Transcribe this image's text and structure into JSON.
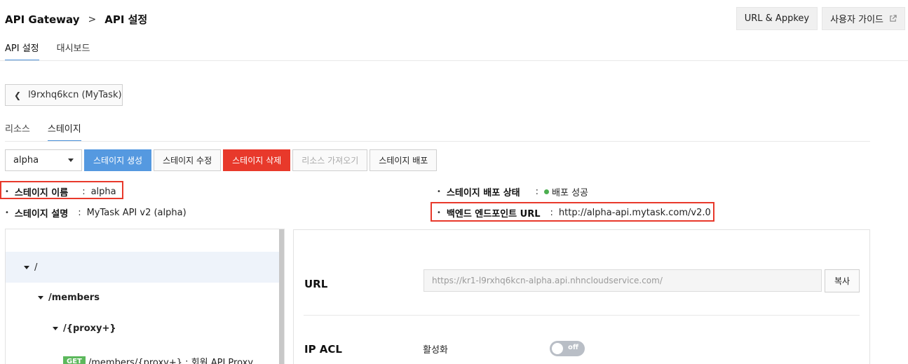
{
  "breadcrumb": {
    "root": "API Gateway",
    "separator": ">",
    "current": "API 설정"
  },
  "top_buttons": {
    "url_appkey": "URL & Appkey",
    "user_guide": "사용자 가이드"
  },
  "main_tabs": [
    {
      "label": "API 설정",
      "active": true
    },
    {
      "label": "대시보드",
      "active": false
    }
  ],
  "back_button": {
    "label": "l9rxhq6kcn (MyTask)"
  },
  "sub_tabs": [
    {
      "label": "리소스",
      "active": false
    },
    {
      "label": "스테이지",
      "active": true
    }
  ],
  "toolbar": {
    "stage_select": "alpha",
    "create": "스테이지 생성",
    "edit": "스테이지 수정",
    "delete": "스테이지 삭제",
    "import": "리소스 가져오기",
    "deploy": "스테이지 배포"
  },
  "stage_info": {
    "name_label": "스테이지 이름",
    "name_value": "alpha",
    "desc_label": "스테이지 설명",
    "desc_value": "MyTask API v2 (alpha)",
    "deploy_label": "스테이지 배포 상태",
    "deploy_value": "배포 성공",
    "backend_label": "백엔드 엔드포인트 URL",
    "backend_value": "http://alpha-api.mytask.com/v2.0",
    "colon": ":",
    "bullet": "•"
  },
  "tree": {
    "root": "/",
    "members": "/members",
    "proxy": "/{proxy+}",
    "method": "GET",
    "method_desc": "/members/{proxy+} : 회원 API Proxy"
  },
  "panel": {
    "url_label": "URL",
    "url_value": "https://kr1-l9rxhq6kcn-alpha.api.nhncloudservice.com/",
    "copy": "복사",
    "ip_acl_label": "IP ACL",
    "activate": "활성화",
    "toggle": "off"
  },
  "colors": {
    "accent": "#4a90d9",
    "primary": "#5599e0",
    "danger": "#e8392b",
    "success": "#4caf50",
    "get_badge": "#5cb85c"
  }
}
